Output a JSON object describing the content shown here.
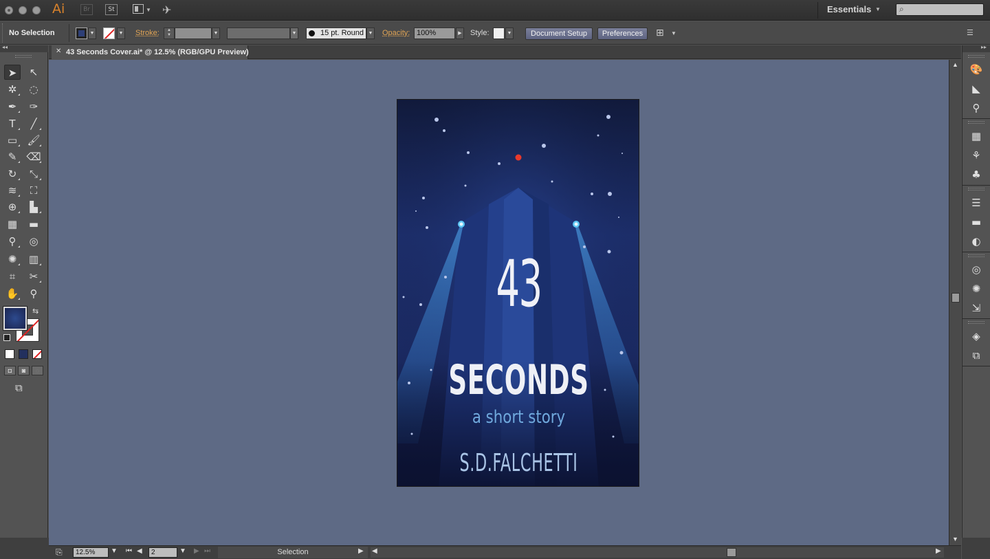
{
  "titlebar": {
    "app_logo": "Ai",
    "bridge_label": "Br",
    "stock_label": "St",
    "workspace": "Essentials",
    "search_placeholder": ""
  },
  "control_bar": {
    "selection_status": "No Selection",
    "stroke_label": "Stroke:",
    "brush_label": "15 pt. Round",
    "opacity_label": "Opacity:",
    "opacity_value": "100%",
    "style_label": "Style:",
    "document_setup": "Document Setup",
    "preferences": "Preferences"
  },
  "document_tab": {
    "title": "43 Seconds Cover.ai* @ 12.5% (RGB/GPU Preview)"
  },
  "artboard": {
    "number": "43",
    "word": "SECONDS",
    "subtitle": "a short story",
    "author": "S.D.FALCHETTI"
  },
  "status_bar": {
    "zoom": "12.5%",
    "artboard_number": "2",
    "tool_mode": "Selection"
  },
  "colors": {
    "fill": "#2d3f77",
    "canvas_bg": "#5e6a85",
    "accent_orange": "#e0a455",
    "cover_red_star": "#e8392b",
    "cover_light": "#5ec7f5"
  }
}
